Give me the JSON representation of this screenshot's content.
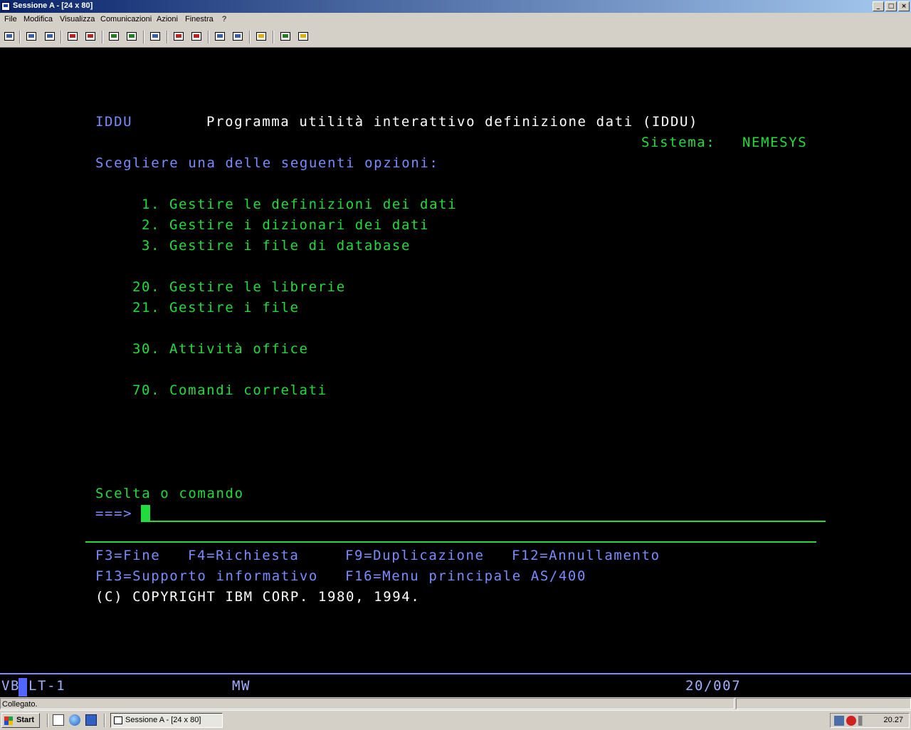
{
  "window": {
    "title": "Sessione A - [24 x 80]",
    "controls": [
      "_",
      "□",
      "×"
    ]
  },
  "menubar": {
    "items": [
      "File",
      "Modifica",
      "Visualizza",
      "Comunicazioni",
      "Azioni",
      "Finestra",
      "?"
    ]
  },
  "toolbar": {
    "icons": [
      "print-screen-icon",
      "copy-icon",
      "paste-icon",
      "send-icon",
      "receive-icon",
      "display-icon",
      "keyboard-icon",
      "macro-icon",
      "record-icon",
      "play-icon",
      "stop-icon",
      "quick-map-icon",
      "clipboard-icon",
      "globe-icon",
      "help-icon"
    ]
  },
  "screen": {
    "program_id": "IDDU",
    "title": "Programma utilità interattivo definizione dati (IDDU)",
    "system_label": "Sistema:",
    "system_value": "NEMESYS",
    "instruction": "Scegliere una delle seguenti opzioni:",
    "options": [
      {
        "num": "1.",
        "label": "Gestire le definizioni dei dati"
      },
      {
        "num": "2.",
        "label": "Gestire i dizionari dei dati"
      },
      {
        "num": "3.",
        "label": "Gestire i file di database"
      },
      {
        "num": "20.",
        "label": "Gestire le librerie"
      },
      {
        "num": "21.",
        "label": "Gestire i file"
      },
      {
        "num": "30.",
        "label": "Attività office"
      },
      {
        "num": "70.",
        "label": "Comandi correlati"
      }
    ],
    "command_label": "Scelta o comando",
    "command_prompt": "===>",
    "command_value": "",
    "function_keys": {
      "f3": "F3=Fine",
      "f4": "F4=Richiesta",
      "f9": "F9=Duplicazione",
      "f12": "F12=Annullamento",
      "f13": "F13=Supporto informativo",
      "f16": "F16=Menu principale AS/400"
    },
    "copyright": "(C) COPYRIGHT IBM CORP. 1980, 1994."
  },
  "oia": {
    "left_a": "VB",
    "left_b": "LT-1",
    "mode": "MW",
    "cursor_pos": "20/007"
  },
  "statusbar": {
    "text": "Collegato."
  },
  "taskbar": {
    "start_label": "Start",
    "task_label": "Sessione A - [24 x 80]",
    "clock": "20.27"
  }
}
